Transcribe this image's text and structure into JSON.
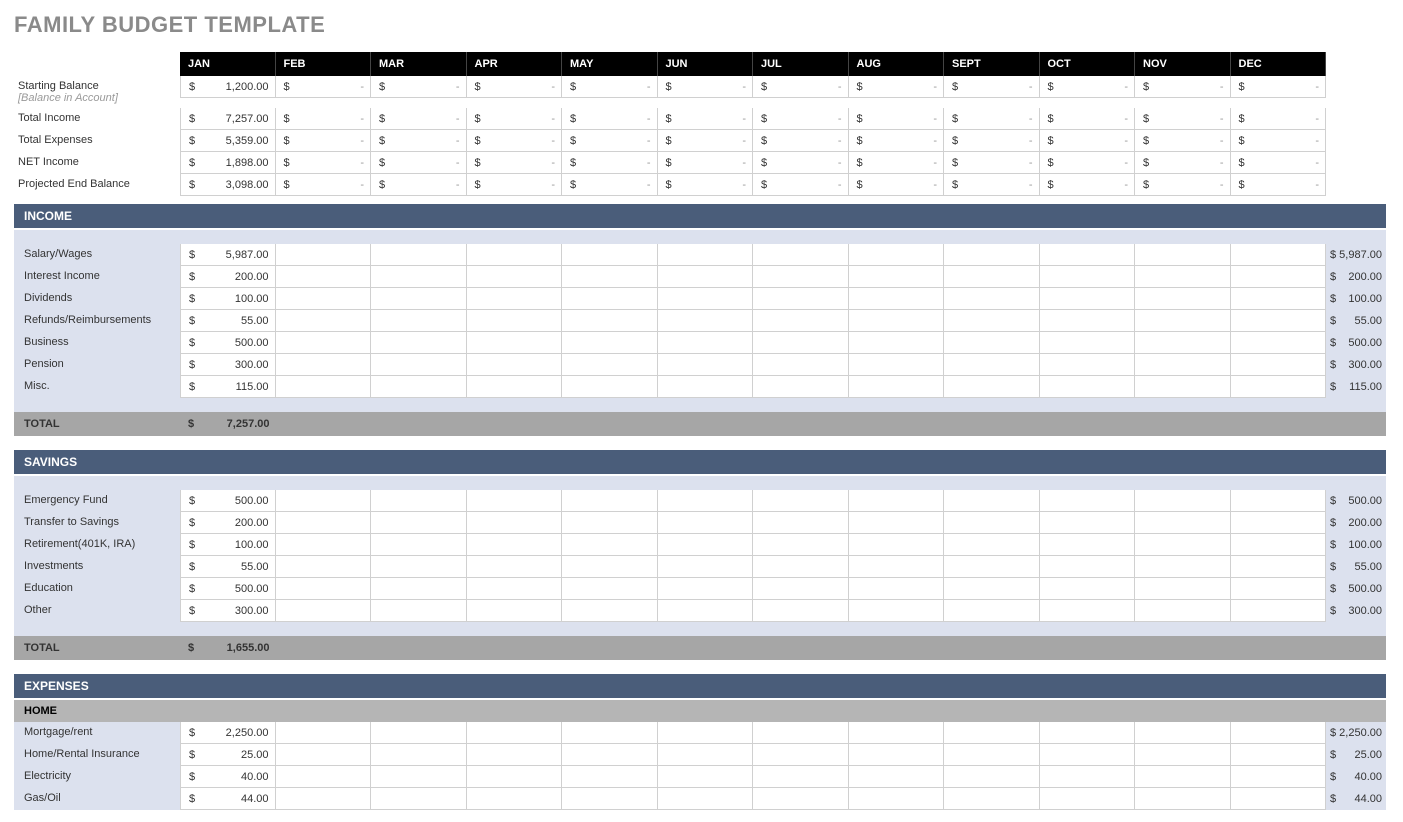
{
  "title": "FAMILY BUDGET TEMPLATE",
  "months": [
    "JAN",
    "FEB",
    "MAR",
    "APR",
    "MAY",
    "JUN",
    "JUL",
    "AUG",
    "SEPT",
    "OCT",
    "NOV",
    "DEC"
  ],
  "currency": "$",
  "dash": "-",
  "summary": [
    {
      "label": "Starting Balance",
      "sublabel": "[Balance in Account]",
      "values": [
        "1,200.00",
        "-",
        "-",
        "-",
        "-",
        "-",
        "-",
        "-",
        "-",
        "-",
        "-",
        "-"
      ]
    },
    {
      "label": "Total Income",
      "values": [
        "7,257.00",
        "-",
        "-",
        "-",
        "-",
        "-",
        "-",
        "-",
        "-",
        "-",
        "-",
        "-"
      ]
    },
    {
      "label": "Total Expenses",
      "values": [
        "5,359.00",
        "-",
        "-",
        "-",
        "-",
        "-",
        "-",
        "-",
        "-",
        "-",
        "-",
        "-"
      ]
    },
    {
      "label": "NET Income",
      "values": [
        "1,898.00",
        "-",
        "-",
        "-",
        "-",
        "-",
        "-",
        "-",
        "-",
        "-",
        "-",
        "-"
      ]
    },
    {
      "label": "Projected End Balance",
      "values": [
        "3,098.00",
        "-",
        "-",
        "-",
        "-",
        "-",
        "-",
        "-",
        "-",
        "-",
        "-",
        "-"
      ]
    }
  ],
  "sections": [
    {
      "name": "INCOME",
      "rows": [
        {
          "label": "Salary/Wages",
          "jan": "5,987.00",
          "total": "$ 5,987.00"
        },
        {
          "label": "Interest Income",
          "jan": "200.00",
          "total": "$   200.00"
        },
        {
          "label": "Dividends",
          "jan": "100.00",
          "total": "$   100.00"
        },
        {
          "label": "Refunds/Reimbursements",
          "jan": "55.00",
          "total": "$     55.00"
        },
        {
          "label": "Business",
          "jan": "500.00",
          "total": "$   500.00"
        },
        {
          "label": "Pension",
          "jan": "300.00",
          "total": "$   300.00"
        },
        {
          "label": "Misc.",
          "jan": "115.00",
          "total": "$   115.00"
        }
      ],
      "total_label": "TOTAL",
      "total": "7,257.00"
    },
    {
      "name": "SAVINGS",
      "rows": [
        {
          "label": "Emergency Fund",
          "jan": "500.00",
          "total": "$   500.00"
        },
        {
          "label": "Transfer to Savings",
          "jan": "200.00",
          "total": "$   200.00"
        },
        {
          "label": "Retirement(401K, IRA)",
          "jan": "100.00",
          "total": "$   100.00"
        },
        {
          "label": "Investments",
          "jan": "55.00",
          "total": "$     55.00"
        },
        {
          "label": "Education",
          "jan": "500.00",
          "total": "$   500.00"
        },
        {
          "label": "Other",
          "jan": "300.00",
          "total": "$   300.00"
        }
      ],
      "total_label": "TOTAL",
      "total": "1,655.00"
    },
    {
      "name": "EXPENSES",
      "sub": "HOME",
      "rows": [
        {
          "label": "Mortgage/rent",
          "jan": "2,250.00",
          "total": "$ 2,250.00"
        },
        {
          "label": "Home/Rental Insurance",
          "jan": "25.00",
          "total": "$     25.00"
        },
        {
          "label": "Electricity",
          "jan": "40.00",
          "total": "$     40.00"
        },
        {
          "label": "Gas/Oil",
          "jan": "44.00",
          "total": "$     44.00"
        }
      ]
    }
  ]
}
